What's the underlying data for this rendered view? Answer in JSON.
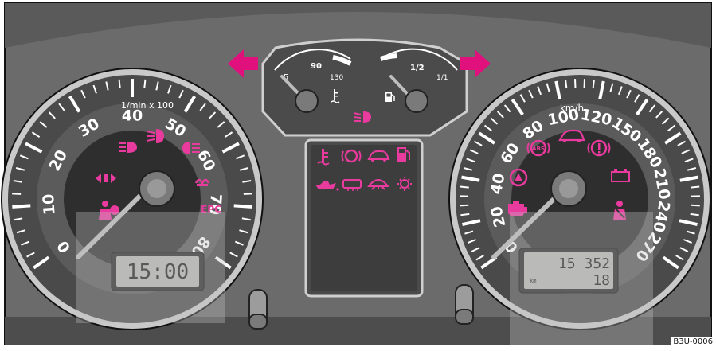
{
  "colors": {
    "background": "#6f6f6f",
    "dial_face": "#3b3b3b",
    "warning_pink": "#e93a9e",
    "arrow_magenta": "#e0107d"
  },
  "tachometer": {
    "unit_label": "1/min x 100",
    "scale": [
      "0",
      "10",
      "20",
      "30",
      "40",
      "50",
      "60",
      "70",
      "80"
    ],
    "needle_value": 0,
    "lights": [
      "high-beam",
      "front-fog",
      "rear-fog",
      "turn-signal",
      "glow-plug",
      "airbag",
      "EPC"
    ],
    "epc_label": "EPC",
    "clock": "15:00"
  },
  "speedometer": {
    "unit_label": "km/h",
    "scale": [
      "0",
      "20",
      "40",
      "60",
      "80",
      "100",
      "120",
      "150",
      "180",
      "210",
      "240",
      "270"
    ],
    "needle_value": 0,
    "lights": [
      "abs",
      "door-open",
      "brake",
      "traction-control",
      "battery",
      "engine-check",
      "seat-belt"
    ],
    "odometer": "15 352",
    "trip": "18",
    "odometer_unit": "km"
  },
  "temperature_gauge": {
    "labels": [
      "5",
      "90",
      "130"
    ]
  },
  "fuel_gauge": {
    "labels": [
      "1/2",
      "1/1"
    ]
  },
  "center_panel": {
    "row1": [
      "coolant-temp",
      "brake-pad",
      "door-open",
      "fuel-reserve"
    ],
    "row2": [
      "oil-pressure",
      "washer-fluid",
      "bulb-check",
      "light-failure"
    ]
  },
  "code": "B3U-0006"
}
